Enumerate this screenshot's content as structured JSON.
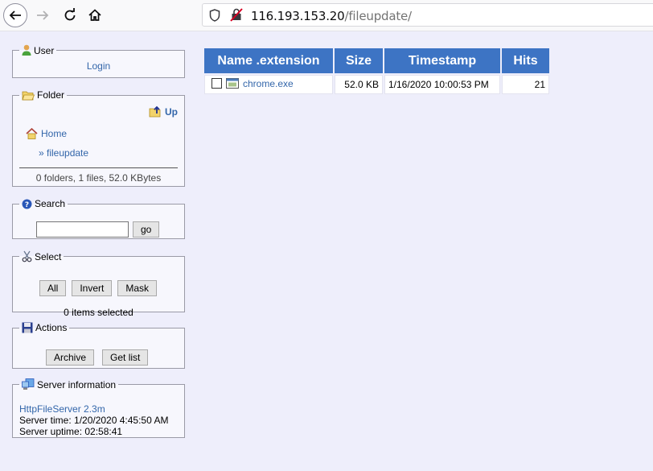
{
  "browser": {
    "url_host": "116.193.153.20",
    "url_path": "/fileupdate/"
  },
  "user": {
    "legend": "User",
    "login_label": "Login"
  },
  "folder": {
    "legend": "Folder",
    "up_label": "Up",
    "home_label": "Home",
    "current_label": "» fileupdate",
    "summary": "0 folders, 1 files, 52.0 KBytes"
  },
  "search": {
    "legend": "Search",
    "value": "",
    "go_label": "go"
  },
  "select": {
    "legend": "Select",
    "all_label": "All",
    "invert_label": "Invert",
    "mask_label": "Mask",
    "status": "0 items selected"
  },
  "actions": {
    "legend": "Actions",
    "archive_label": "Archive",
    "getlist_label": "Get list"
  },
  "server": {
    "legend": "Server information",
    "software": "HttpFileServer 2.3m",
    "time": "Server time: 1/20/2020 4:45:50 AM",
    "uptime": "Server uptime: 02:58:41"
  },
  "files": {
    "columns": [
      "Name .extension",
      "Size",
      "Timestamp",
      "Hits"
    ],
    "rows": [
      {
        "name": "chrome.exe",
        "size": "52.0 KB",
        "timestamp": "1/16/2020 10:00:53 PM",
        "hits": "21"
      }
    ]
  },
  "colors": {
    "header_bg": "#3d74c4",
    "link": "#3366aa",
    "page_bg": "#eeeefb"
  }
}
